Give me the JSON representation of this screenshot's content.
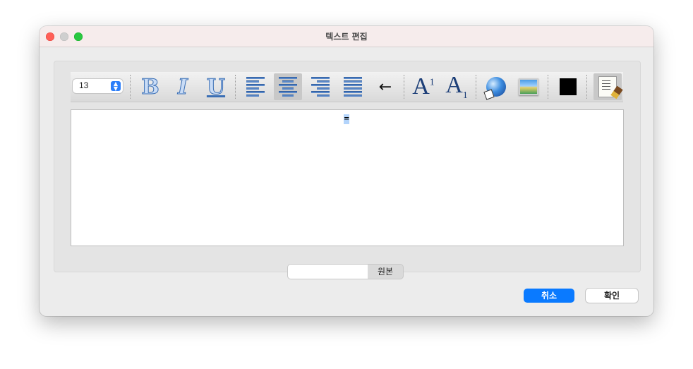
{
  "window": {
    "title": "텍스트 편집"
  },
  "toolbar": {
    "font_size": "13",
    "bold_glyph": "B",
    "italic_glyph": "I",
    "underline_glyph": "U",
    "arrow_glyph": "←",
    "superscript_glyph": "A",
    "superscript_mark": "1",
    "subscript_glyph": "A",
    "subscript_mark": "1",
    "text_color": "#000000",
    "icons": [
      "bold-icon",
      "italic-icon",
      "underline-icon",
      "align-left-icon",
      "align-center-icon",
      "align-right-icon",
      "align-justify-icon",
      "left-arrow-icon",
      "superscript-icon",
      "subscript-icon",
      "link-globe-icon",
      "image-icon",
      "color-swatch-icon",
      "clean-format-icon"
    ]
  },
  "editor": {
    "content_mark": "="
  },
  "bottom": {
    "source_tab_label": "원본"
  },
  "buttons": {
    "cancel_label": "취소",
    "ok_label": "확인"
  },
  "colors": {
    "accent": "#0a7aff",
    "close": "#ff5f57",
    "maximize": "#28c840"
  }
}
